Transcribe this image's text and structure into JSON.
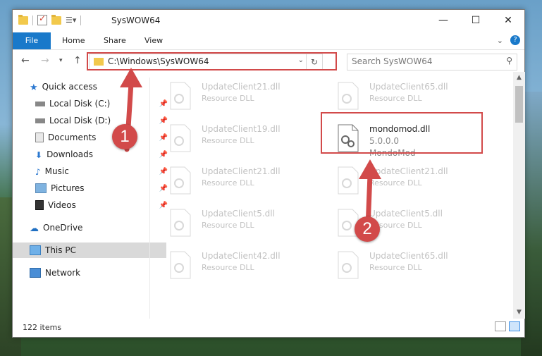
{
  "window": {
    "title": "SysWOW64",
    "controls": [
      "minimize",
      "maximize",
      "close"
    ]
  },
  "ribbon": {
    "tabs": [
      "File",
      "Home",
      "Share",
      "View"
    ]
  },
  "nav": {
    "address": "C:\\Windows\\SysWOW64",
    "search_placeholder": "Search SysWOW64"
  },
  "sidebar": {
    "items": [
      {
        "label": "Quick access",
        "icon": "star-icon",
        "pinned": false
      },
      {
        "label": "Local Disk (C:)",
        "icon": "drive-icon",
        "pinned": true
      },
      {
        "label": "Local Disk (D:)",
        "icon": "drive-icon",
        "pinned": true
      },
      {
        "label": "Documents",
        "icon": "documents-icon",
        "pinned": true
      },
      {
        "label": "Downloads",
        "icon": "download-icon",
        "pinned": true
      },
      {
        "label": "Music",
        "icon": "music-icon",
        "pinned": true
      },
      {
        "label": "Pictures",
        "icon": "pictures-icon",
        "pinned": true
      },
      {
        "label": "Videos",
        "icon": "videos-icon",
        "pinned": true
      },
      {
        "label": "OneDrive",
        "icon": "cloud-icon",
        "pinned": false
      },
      {
        "label": "This PC",
        "icon": "pc-icon",
        "pinned": false,
        "selected": true
      },
      {
        "label": "Network",
        "icon": "network-icon",
        "pinned": false
      }
    ]
  },
  "files": {
    "left": [
      {
        "name": "UpdateClient21.dll",
        "type": "Resource DLL"
      },
      {
        "name": "UpdateClient19.dll",
        "type": "Resource DLL"
      },
      {
        "name": "UpdateClient21.dll",
        "type": "Resource DLL"
      },
      {
        "name": "UpdateClient5.dll",
        "type": "Resource DLL"
      },
      {
        "name": "UpdateClient42.dll",
        "type": "Resource DLL"
      }
    ],
    "right": [
      {
        "name": "UpdateClient65.dll",
        "type": "Resource DLL"
      },
      {
        "name": "mondomod.dll",
        "version": "5.0.0.0",
        "description": "MondoMod",
        "highlighted": true
      },
      {
        "name": "UpdateClient21.dll",
        "type": "Resource DLL"
      },
      {
        "name": "UpdateClient5.dll",
        "type": "Resource DLL"
      },
      {
        "name": "UpdateClient65.dll",
        "type": "Resource DLL"
      }
    ]
  },
  "status": {
    "item_count": "122 items"
  },
  "annotations": {
    "badge1": "1",
    "badge2": "2",
    "color": "#d24a4a"
  }
}
